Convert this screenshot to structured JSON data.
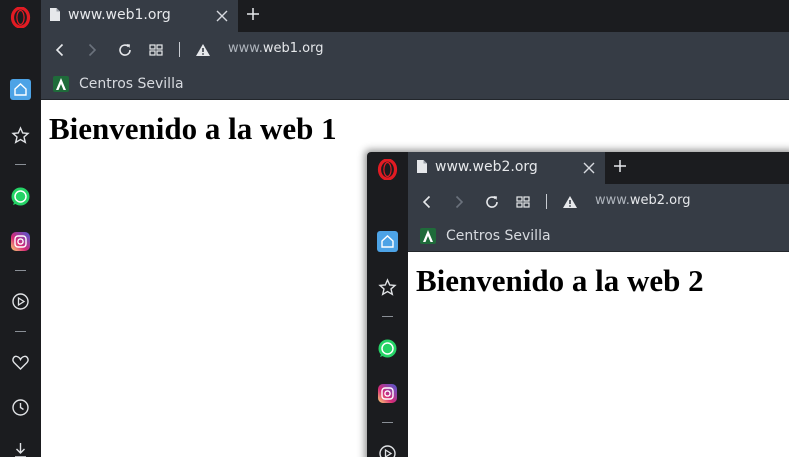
{
  "windows": [
    {
      "tab_title": "www.web1.org",
      "address_prefix": "www.",
      "address_domain": "web1.org",
      "bookmark_label": "Centros Sevilla",
      "page_heading": "Bienvenido a la web 1"
    },
    {
      "tab_title": "www.web2.org",
      "address_prefix": "www.",
      "address_domain": "web2.org",
      "bookmark_label": "Centros Sevilla",
      "page_heading": "Bienvenido a la web 2"
    }
  ],
  "sidebar_icons": [
    "home-icon",
    "star-icon",
    "whatsapp-icon",
    "instagram-icon",
    "player-icon",
    "heart-icon",
    "history-icon",
    "download-icon"
  ],
  "colors": {
    "chrome_dark": "#1b1c1f",
    "toolbar": "#363c45",
    "opera_red": "#e21b23",
    "home_active": "#4da3e6",
    "whatsapp": "#25d366",
    "bookmark_favicon": "#1f6b3a"
  }
}
